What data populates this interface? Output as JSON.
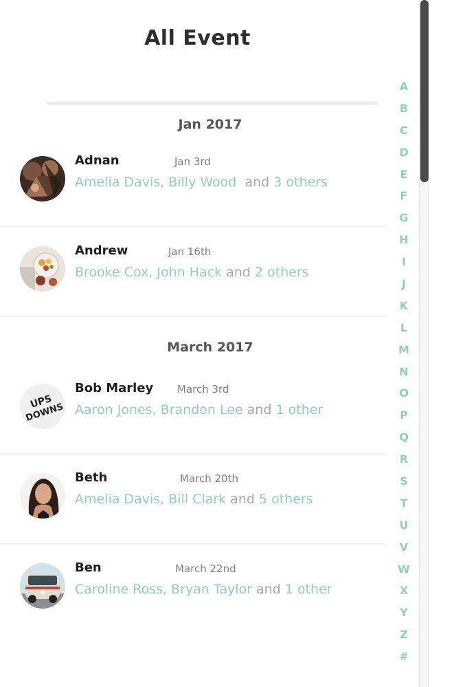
{
  "header": {
    "title": "All Event"
  },
  "sections": [
    {
      "label": "Jan 2017",
      "events": [
        {
          "name": "Adnan",
          "date": "Jan 3rd",
          "participants": "Amelia Davis, Billy Wood",
          "and_text": "and",
          "others": "3 others",
          "avatar_icon": "group-photo-avatar"
        },
        {
          "name": "Andrew",
          "date": "Jan 16th",
          "participants": "Brooke Cox, John Hack",
          "and_text": "and",
          "others": "2 others",
          "avatar_icon": "food-bowl-avatar"
        }
      ]
    },
    {
      "label": "March 2017",
      "events": [
        {
          "name": "Bob Marley",
          "date": "March 3rd",
          "participants": "Aaron Jones, Brandon Lee",
          "and_text": "and",
          "others": "1 other",
          "avatar_icon": "ups-downs-logo-avatar"
        },
        {
          "name": "Beth",
          "date": "March 20th",
          "participants": "Amelia Davis, Bill Clark",
          "and_text": "and",
          "others": "5 others",
          "avatar_icon": "portrait-avatar"
        },
        {
          "name": "Ben",
          "date": "March 22nd",
          "participants": "Caroline Ross, Bryan Taylor",
          "and_text": "and",
          "others": "1 other",
          "avatar_icon": "van-photo-avatar"
        }
      ]
    }
  ],
  "avatar_text": {
    "ups_downs_line1": "UPS",
    "ups_downs_line2": "DOWNS"
  },
  "alphabet": [
    "A",
    "B",
    "C",
    "D",
    "E",
    "F",
    "G",
    "H",
    "I",
    "J",
    "K",
    "L",
    "M",
    "N",
    "O",
    "P",
    "Q",
    "R",
    "S",
    "T",
    "U",
    "V",
    "W",
    "X",
    "Y",
    "Z",
    "#"
  ],
  "colors": {
    "accent": "#8fd0bb",
    "muted": "#a8a8a8",
    "text": "#1f1f1f",
    "header": "#555555"
  }
}
